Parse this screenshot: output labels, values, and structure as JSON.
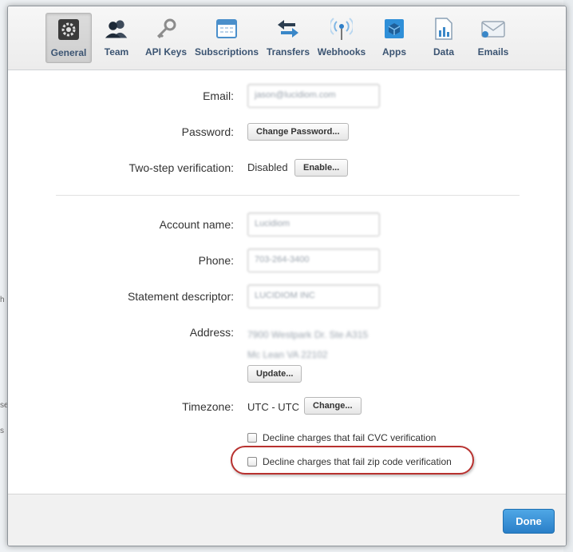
{
  "tabs": [
    {
      "label": "General",
      "icon": "gear-icon",
      "active": true
    },
    {
      "label": "Team",
      "icon": "team-icon",
      "active": false
    },
    {
      "label": "API Keys",
      "icon": "key-icon",
      "active": false
    },
    {
      "label": "Subscriptions",
      "icon": "calendar-icon",
      "active": false
    },
    {
      "label": "Transfers",
      "icon": "transfer-arrows-icon",
      "active": false
    },
    {
      "label": "Webhooks",
      "icon": "broadcast-icon",
      "active": false
    },
    {
      "label": "Apps",
      "icon": "cube-icon",
      "active": false
    },
    {
      "label": "Data",
      "icon": "document-chart-icon",
      "active": false
    },
    {
      "label": "Emails",
      "icon": "envelope-icon",
      "active": false
    }
  ],
  "email": {
    "label": "Email:",
    "value": "jason@lucidiom.com"
  },
  "password": {
    "label": "Password:",
    "button": "Change Password..."
  },
  "two_step": {
    "label": "Two-step verification:",
    "status": "Disabled",
    "button": "Enable..."
  },
  "account_name": {
    "label": "Account name:",
    "value": "Lucidiom"
  },
  "phone": {
    "label": "Phone:",
    "value": "703-264-3400"
  },
  "statement": {
    "label": "Statement descriptor:",
    "value": "LUCIDIOM INC"
  },
  "address": {
    "label": "Address:",
    "line1": "7900 Westpark Dr. Ste A315",
    "line2": "Mc Lean VA 22102",
    "button": "Update..."
  },
  "timezone": {
    "label": "Timezone:",
    "value": "UTC - UTC",
    "button": "Change..."
  },
  "checks": {
    "cvc": {
      "label": "Decline charges that fail CVC verification",
      "checked": false
    },
    "zip": {
      "label": "Decline charges that fail zip code verification",
      "checked": false
    }
  },
  "footer": {
    "done": "Done"
  },
  "background": {
    "fragments": [
      "h",
      "se",
      "s"
    ]
  },
  "colors": {
    "accent": "#2a7fc8",
    "highlight": "#b8312f",
    "tab_text": "#3b5472"
  }
}
